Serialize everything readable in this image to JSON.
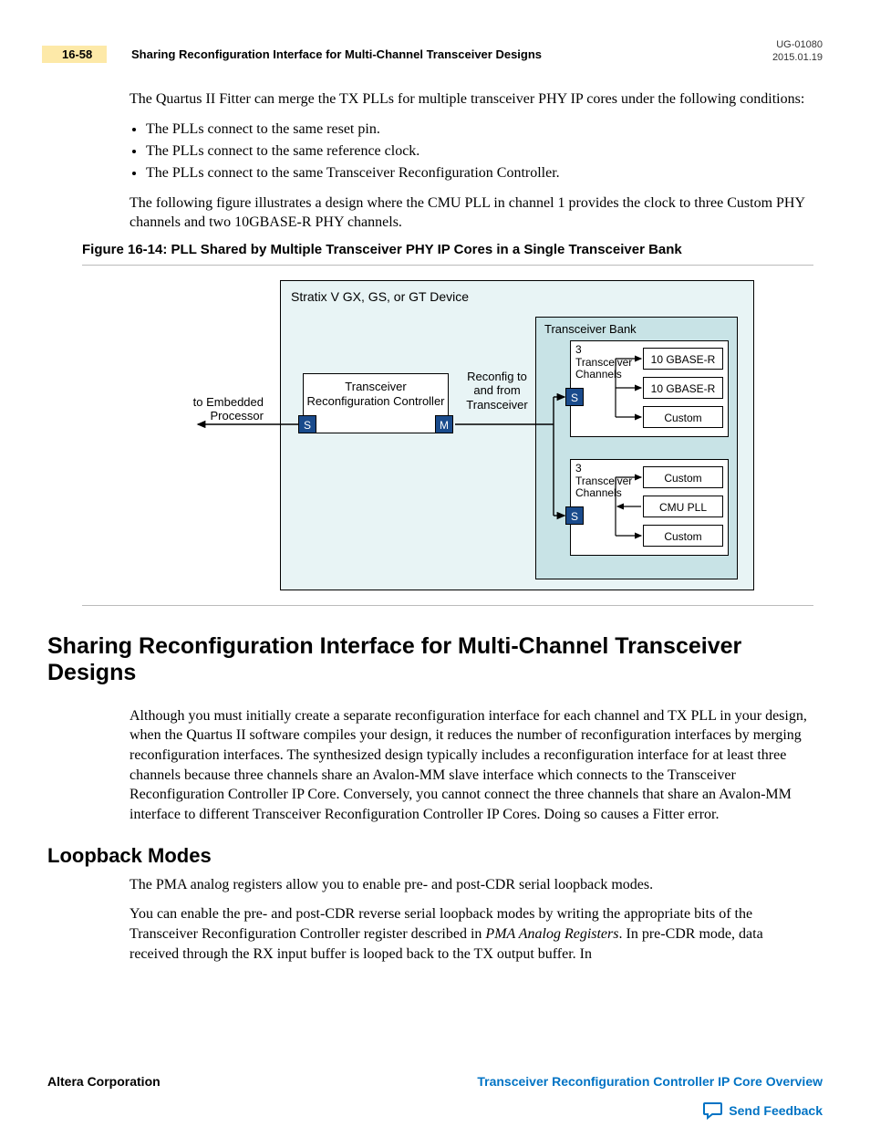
{
  "header": {
    "page_number": "16-58",
    "title": "Sharing Reconfiguration Interface for Multi-Channel Transceiver Designs",
    "doc_id": "UG-01080",
    "date": "2015.01.19"
  },
  "intro_para": "The Quartus II Fitter can merge the TX PLLs for multiple transceiver PHY IP cores under the following conditions:",
  "bullets": [
    "The PLLs connect to the same reset pin.",
    "The PLLs connect to the same reference clock.",
    "The PLLs connect to the same Transceiver Reconfiguration Controller."
  ],
  "para2": "The following figure illustrates a design where the CMU PLL in channel 1 provides the clock to three Custom PHY channels and two 10GBASE-R PHY channels.",
  "figure": {
    "caption": "Figure 16-14: PLL Shared by Multiple Transceiver PHY IP Cores in a Single Transceiver Bank",
    "device_label": "Stratix V GX, GS, or GT Device",
    "trc_label": "Transceiver Reconfiguration Controller",
    "port_s": "S",
    "port_m": "M",
    "reconfig_label": "Reconfig to and from Transceiver",
    "embedded_label": "to Embedded Processor",
    "bank_label": "Transceiver Bank",
    "ch_label1": "3 Transceiver Channels",
    "ch_label2": "3 Transceiver Channels",
    "rows": {
      "r1": "10 GBASE-R",
      "r2": "10 GBASE-R",
      "r3": "Custom",
      "r4": "Custom",
      "r5": "CMU PLL",
      "r6": "Custom"
    }
  },
  "section1": {
    "heading": "Sharing Reconfiguration Interface for Multi-Channel Transceiver Designs",
    "para": "Although you must initially create a separate reconfiguration interface for each channel and TX PLL in your design, when the Quartus II software compiles your design, it reduces the number of reconfiguration interfaces by merging reconfiguration interfaces. The synthesized design typically includes a reconfiguration interface for at least three channels because three channels share an Avalon-MM slave interface which connects to the Transceiver Reconfiguration Controller IP Core. Conversely, you cannot connect the three channels that share an Avalon-MM interface to different Transceiver Reconfiguration Controller IP Cores. Doing so causes a Fitter error."
  },
  "section2": {
    "heading": "Loopback Modes",
    "para1": "The PMA analog registers allow you to enable pre- and post-CDR serial loopback modes.",
    "para2a": "You can enable the pre- and post-CDR reverse serial loopback modes by writing the appropriate bits of the Transceiver Reconfiguration Controller ",
    "para2_reg": "",
    "para2b": " register described in ",
    "para2_ref": "PMA Analog Registers",
    "para2c": ". In pre-CDR mode, data received through the RX input buffer is looped back to the TX output buffer. In"
  },
  "footer": {
    "left": "Altera Corporation",
    "right": "Transceiver Reconfiguration Controller IP Core Overview",
    "feedback": "Send Feedback"
  }
}
